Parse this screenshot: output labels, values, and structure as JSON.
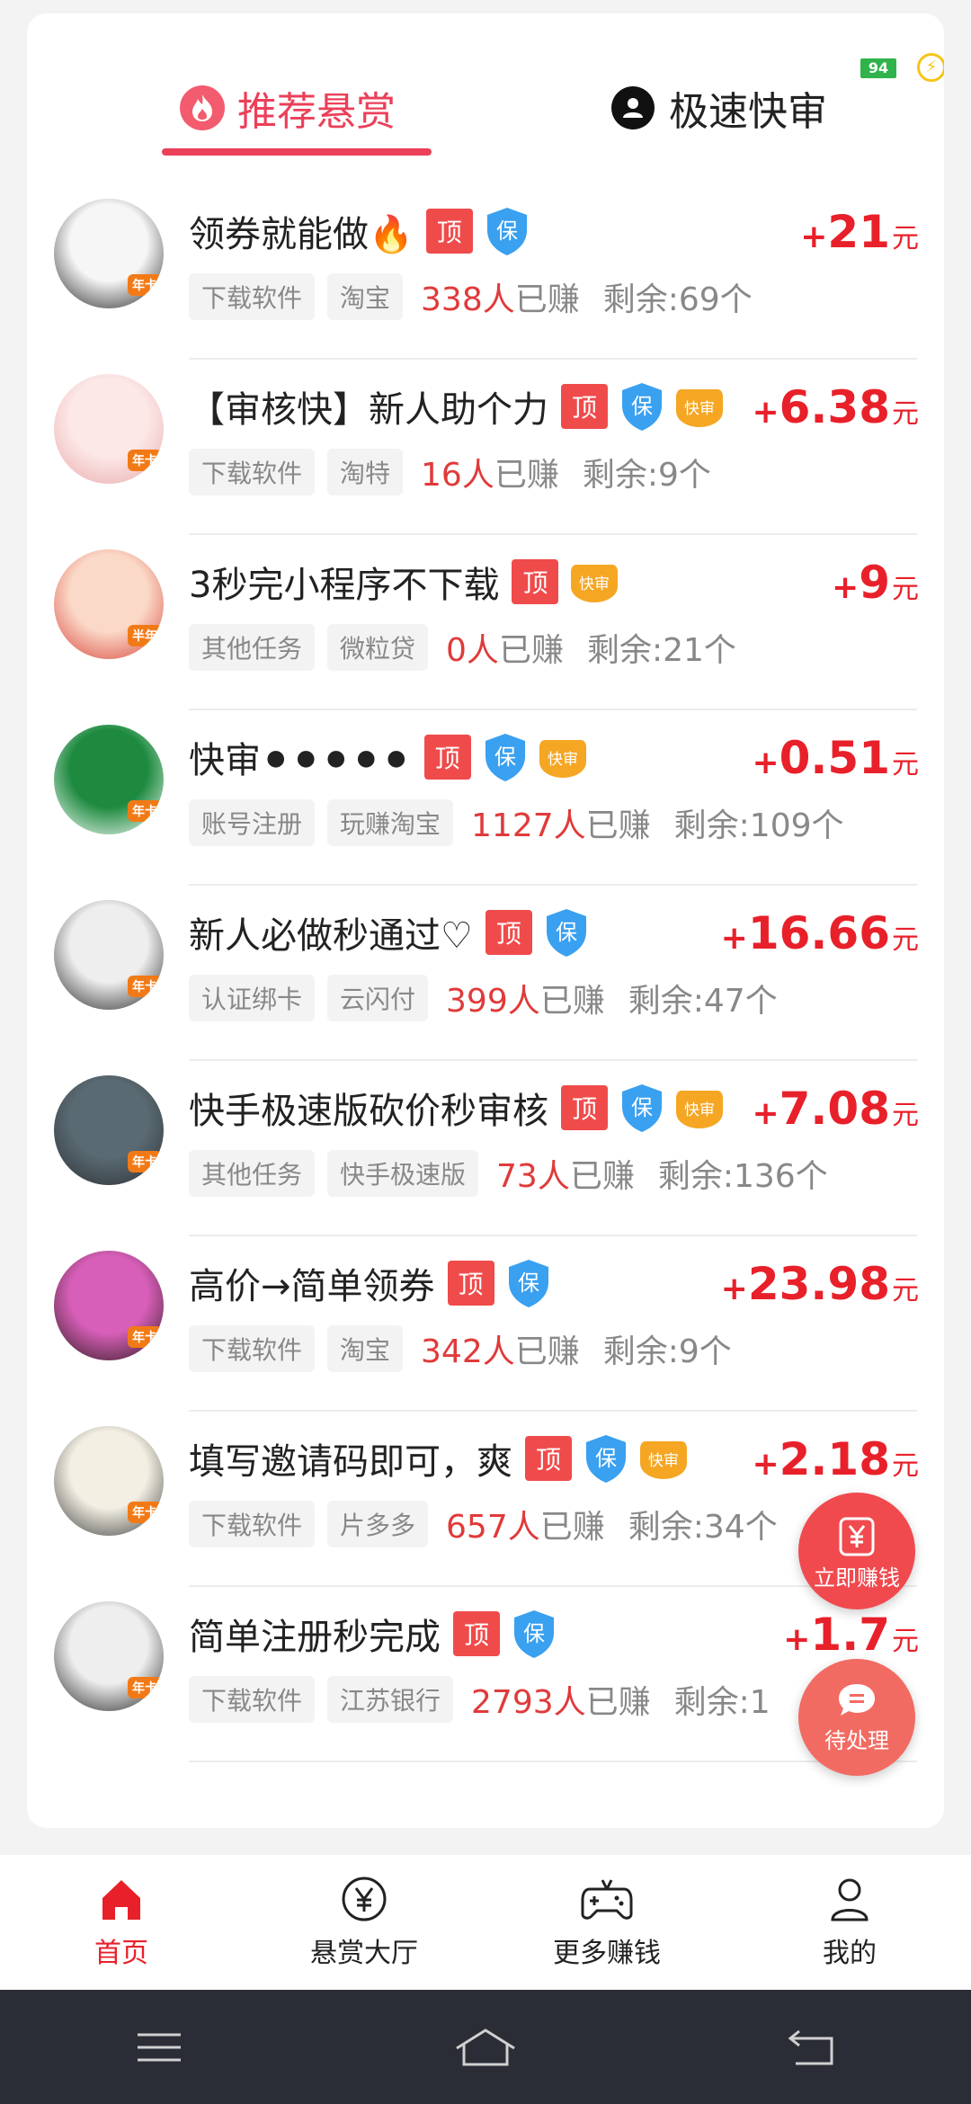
{
  "status": {
    "battery": "94"
  },
  "tabs": [
    {
      "label": "推荐悬赏",
      "active": true
    },
    {
      "label": "极速快审",
      "active": false
    }
  ],
  "tags": {
    "top": "顶",
    "guarantee": "保",
    "fast": "快审"
  },
  "avatar_badges": {
    "year": "年卡",
    "half": "半年"
  },
  "tasks": [
    {
      "title": "领券就能做🔥",
      "badges": [
        "top",
        "guarantee"
      ],
      "reward": "21",
      "category": "下载软件",
      "platform": "淘宝",
      "earned": "338人",
      "remaining": "剩余:69个",
      "avatar_badge": "年卡"
    },
    {
      "title": "【审核快】新人助个力",
      "badges": [
        "top",
        "guarantee",
        "fast"
      ],
      "reward": "6.38",
      "category": "下载软件",
      "platform": "淘特",
      "earned": "16人",
      "remaining": "剩余:9个",
      "avatar_badge": "年卡"
    },
    {
      "title": "3秒完小程序不下载",
      "badges": [
        "top",
        "fast"
      ],
      "reward": "9",
      "category": "其他任务",
      "platform": "微粒贷",
      "earned": "0人",
      "remaining": "剩余:21个",
      "avatar_badge": "半年"
    },
    {
      "title": "快审⚫⚫⚫⚫⚫",
      "badges": [
        "top",
        "guarantee",
        "fast"
      ],
      "reward": "0.51",
      "category": "账号注册",
      "platform": "玩赚淘宝",
      "earned": "1127人",
      "remaining": "剩余:109个",
      "avatar_badge": "年卡"
    },
    {
      "title": "新人必做秒通过♡",
      "badges": [
        "top",
        "guarantee"
      ],
      "reward": "16.66",
      "category": "认证绑卡",
      "platform": "云闪付",
      "earned": "399人",
      "remaining": "剩余:47个",
      "avatar_badge": "年卡"
    },
    {
      "title": "快手极速版砍价秒审核",
      "badges": [
        "top",
        "guarantee",
        "fast"
      ],
      "reward": "7.08",
      "category": "其他任务",
      "platform": "快手极速版",
      "earned": "73人",
      "remaining": "剩余:136个",
      "avatar_badge": "年卡"
    },
    {
      "title": "高价→简单领券",
      "badges": [
        "top",
        "guarantee"
      ],
      "reward": "23.98",
      "category": "下载软件",
      "platform": "淘宝",
      "earned": "342人",
      "remaining": "剩余:9个",
      "avatar_badge": "年卡"
    },
    {
      "title": "填写邀请码即可，爽",
      "badges": [
        "top",
        "guarantee",
        "fast"
      ],
      "reward": "2.18",
      "category": "下载软件",
      "platform": "片多多",
      "earned": "657人",
      "remaining": "剩余:34个",
      "avatar_badge": "年卡"
    },
    {
      "title": "简单注册秒完成",
      "badges": [
        "top",
        "guarantee"
      ],
      "reward": "1.7",
      "category": "下载软件",
      "platform": "江苏银行",
      "earned": "2793人",
      "remaining": "剩余:1",
      "avatar_badge": "年卡"
    }
  ],
  "earned_suffix": "已赚",
  "reward_plus": "+",
  "reward_unit": "元",
  "floating": {
    "earn_now": "立即赚钱",
    "pending": "待处理"
  },
  "bottom_nav": [
    {
      "label": "首页",
      "icon": "home-icon",
      "active": true
    },
    {
      "label": "悬赏大厅",
      "icon": "yen-coin-icon",
      "active": false
    },
    {
      "label": "更多赚钱",
      "icon": "gamepad-icon",
      "active": false
    },
    {
      "label": "我的",
      "icon": "user-icon",
      "active": false
    }
  ],
  "colors": {
    "accent": "#ec3f58",
    "reward": "#e8202a",
    "tag_top": "#f04b4b",
    "tag_guarantee": "#3aa0f0",
    "tag_fast": "#f5a623"
  }
}
